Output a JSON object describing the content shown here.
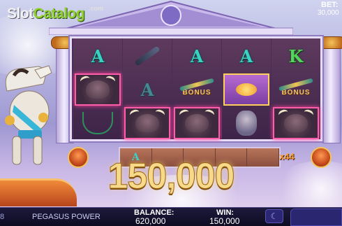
{
  "logo": {
    "slot": "Slot",
    "catalog": "Catalog",
    "com": ".com"
  },
  "win_amount": "150,000",
  "multiplier": "x44",
  "reels": [
    [
      {
        "type": "letter",
        "glyph": "A"
      },
      {
        "type": "bull"
      },
      {
        "type": "trident"
      }
    ],
    [
      {
        "type": "mace"
      },
      {
        "type": "letter",
        "glyph": "A",
        "dim": true
      },
      {
        "type": "bull"
      }
    ],
    [
      {
        "type": "letter",
        "glyph": "A"
      },
      {
        "type": "bonus",
        "label": "BONUS"
      },
      {
        "type": "bull"
      }
    ],
    [
      {
        "type": "letter",
        "glyph": "A"
      },
      {
        "type": "wings"
      },
      {
        "type": "zeus"
      }
    ],
    [
      {
        "type": "letter",
        "glyph": "K"
      },
      {
        "type": "bonus",
        "label": "BONUS"
      },
      {
        "type": "bull"
      }
    ]
  ],
  "strip_symbol": "A",
  "bottom_bar": {
    "number": "8",
    "game_name": "PEGASUS POWER",
    "balance_label": "BALANCE:",
    "balance_value": "620,000",
    "win_label": "WIN:",
    "win_value": "150,000",
    "bet_label": "BET:",
    "bet_value": "30,000"
  }
}
